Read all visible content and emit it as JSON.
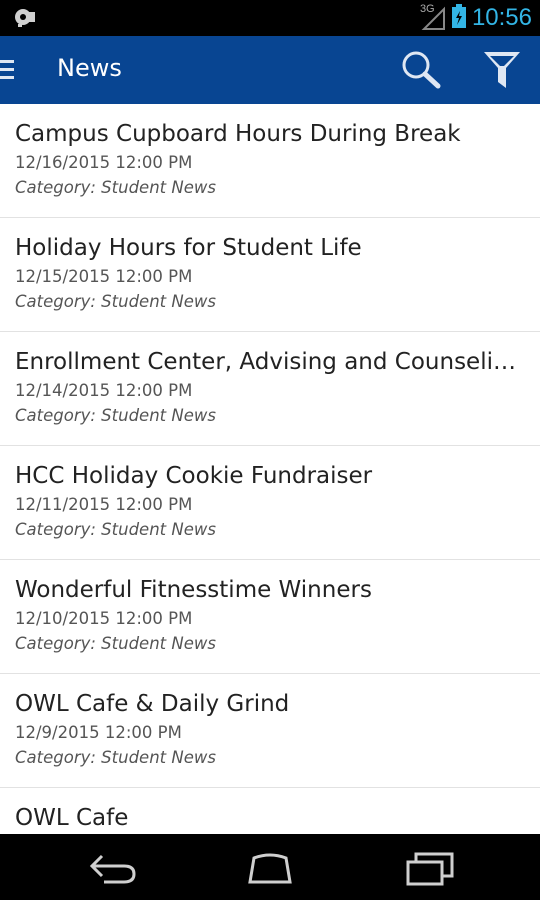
{
  "status_bar": {
    "network": "3G",
    "time": "10:56",
    "accent_color": "#33b5e5"
  },
  "app_bar": {
    "title": "News",
    "background_color": "#084592",
    "icons": [
      "menu-icon",
      "search-icon",
      "filter-icon"
    ]
  },
  "news": [
    {
      "title": "Campus Cupboard Hours During Break",
      "date": "12/16/2015 12:00 PM",
      "category": "Category: Student News"
    },
    {
      "title": "Holiday Hours for Student Life",
      "date": "12/15/2015 12:00 PM",
      "category": "Category: Student News"
    },
    {
      "title": "Enrollment Center, Advising and Counseling…",
      "date": "12/14/2015 12:00 PM",
      "category": "Category: Student News"
    },
    {
      "title": "HCC Holiday Cookie Fundraiser",
      "date": "12/11/2015 12:00 PM",
      "category": "Category: Student News"
    },
    {
      "title": "Wonderful Fitnesstime Winners",
      "date": "12/10/2015 12:00 PM",
      "category": "Category: Student News"
    },
    {
      "title": "OWL Cafe & Daily Grind",
      "date": "12/9/2015 12:00 PM",
      "category": "Category: Student News"
    },
    {
      "title": "OWL Cafe",
      "date": "",
      "category": ""
    }
  ],
  "nav_bar": {
    "icons": [
      "back-icon",
      "home-icon",
      "recent-apps-icon"
    ]
  }
}
